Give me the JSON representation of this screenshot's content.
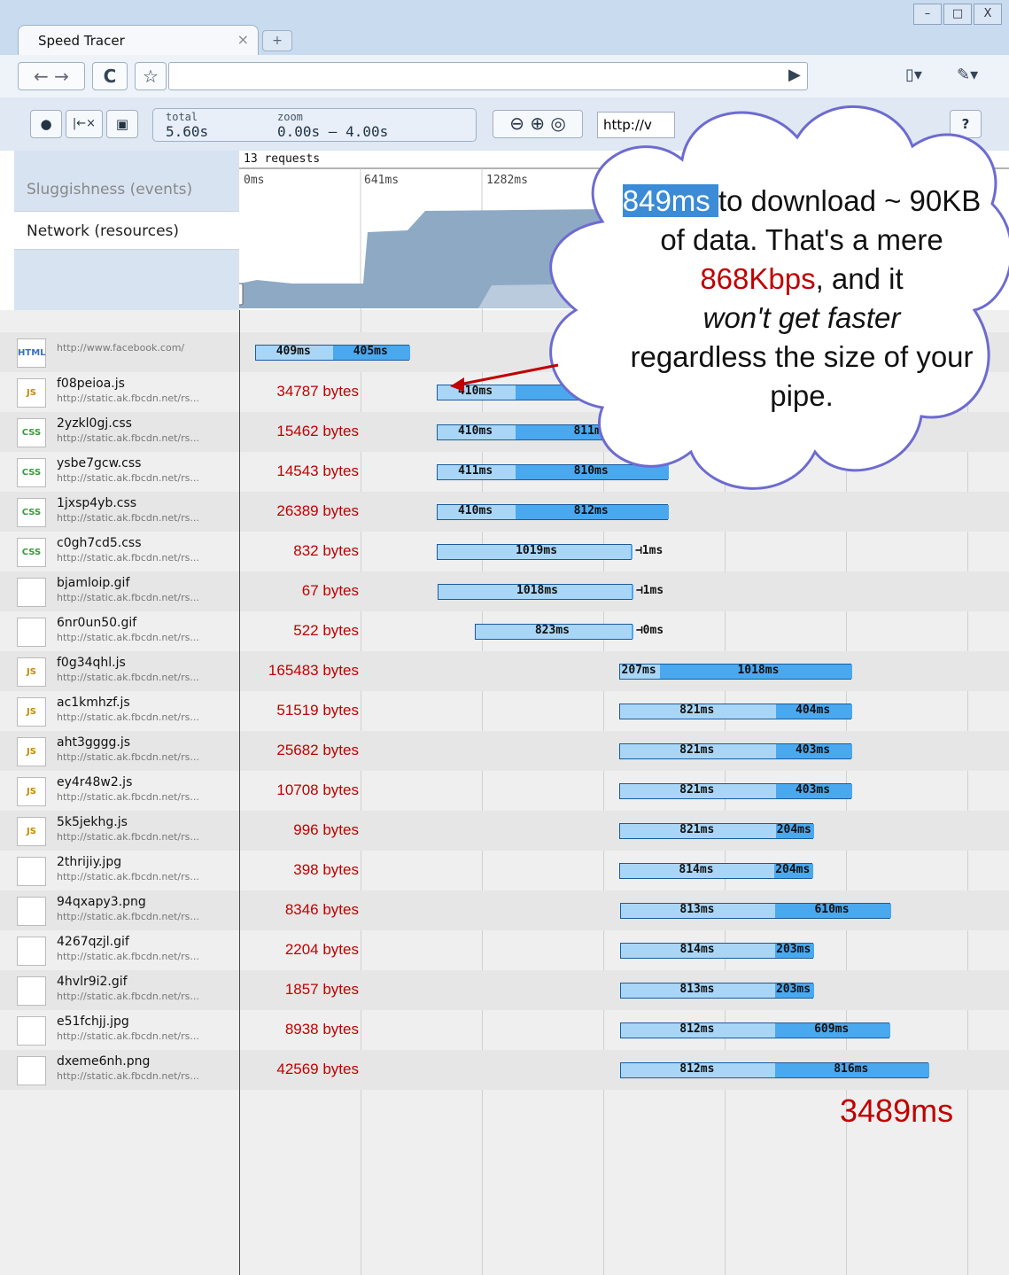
{
  "window": {
    "tab_title": "Speed Tracer",
    "tab_close": "×",
    "new_tab": "+",
    "controls": [
      "–",
      "□",
      "X"
    ]
  },
  "toolbar": {
    "back": "←",
    "forward": "→",
    "reload": "C",
    "star": "☆",
    "go": "▶",
    "page_menu": "▯▾",
    "wrench_menu": "✎▾"
  },
  "tracer": {
    "record_icon": "●",
    "clear_icon": "|←×",
    "save_icon": "▣",
    "total_label": "total",
    "total_value": "5.60s",
    "zoom_label": "zoom",
    "zoom_value": "0.00s – 4.00s",
    "zoom_out": "⊖",
    "zoom_in": "⊕",
    "zoom_fit": "◎",
    "url_value": "http://v",
    "help": "?"
  },
  "overview": {
    "tab_sluggishness": "Sluggishness (events)",
    "tab_network": "Network (resources)",
    "requests_label": "13 requests",
    "ticks": [
      "0ms",
      "641ms",
      "1282ms"
    ]
  },
  "resources": [
    {
      "name": "",
      "url": "http://www.facebook.com/",
      "icon": "HTML",
      "bytes": "",
      "latency": "409ms",
      "download": "405ms",
      "lat_start": 0,
      "lat_ms": 409,
      "dl_ms": 405
    },
    {
      "name": "f08peioa.js",
      "url": "http://static.ak.fbcdn.net/rs...",
      "icon": "JS",
      "bytes": "34787 bytes",
      "latency": "410ms",
      "download": "849ms",
      "lat_start": 960,
      "lat_ms": 410,
      "dl_ms": 849
    },
    {
      "name": "2yzkl0gj.css",
      "url": "http://static.ak.fbcdn.net/rs...",
      "icon": "CSS",
      "bytes": "15462 bytes",
      "latency": "410ms",
      "download": "811ms",
      "lat_start": 960,
      "lat_ms": 410,
      "dl_ms": 811
    },
    {
      "name": "ysbe7gcw.css",
      "url": "http://static.ak.fbcdn.net/rs...",
      "icon": "CSS",
      "bytes": "14543 bytes",
      "latency": "411ms",
      "download": "810ms",
      "lat_start": 960,
      "lat_ms": 411,
      "dl_ms": 810
    },
    {
      "name": "1jxsp4yb.css",
      "url": "http://static.ak.fbcdn.net/rs...",
      "icon": "CSS",
      "bytes": "26389 bytes",
      "latency": "410ms",
      "download": "812ms",
      "lat_start": 960,
      "lat_ms": 410,
      "dl_ms": 812
    },
    {
      "name": "c0gh7cd5.css",
      "url": "http://static.ak.fbcdn.net/rs...",
      "icon": "CSS",
      "bytes": "832 bytes",
      "latency": "1019ms",
      "download": "1ms",
      "lat_start": 960,
      "lat_ms": 1019,
      "dl_ms": 1
    },
    {
      "name": "bjamloip.gif",
      "url": "http://static.ak.fbcdn.net/rs...",
      "icon": "",
      "bytes": "67 bytes",
      "latency": "1018ms",
      "download": "1ms",
      "lat_start": 965,
      "lat_ms": 1018,
      "dl_ms": 1
    },
    {
      "name": "6nr0un50.gif",
      "url": "http://static.ak.fbcdn.net/rs...",
      "icon": "",
      "bytes": "522 bytes",
      "latency": "823ms",
      "download": "0ms",
      "lat_start": 1160,
      "lat_ms": 823,
      "dl_ms": 0
    },
    {
      "name": "f0g34qhl.js",
      "url": "http://static.ak.fbcdn.net/rs...",
      "icon": "JS",
      "bytes": "165483 bytes",
      "latency": "207ms",
      "download": "1018ms",
      "lat_start": 1925,
      "lat_ms": 207,
      "dl_ms": 1018
    },
    {
      "name": "ac1kmhzf.js",
      "url": "http://static.ak.fbcdn.net/rs...",
      "icon": "JS",
      "bytes": "51519 bytes",
      "latency": "821ms",
      "download": "404ms",
      "lat_start": 1925,
      "lat_ms": 821,
      "dl_ms": 404
    },
    {
      "name": "aht3gggg.js",
      "url": "http://static.ak.fbcdn.net/rs...",
      "icon": "JS",
      "bytes": "25682 bytes",
      "latency": "821ms",
      "download": "403ms",
      "lat_start": 1925,
      "lat_ms": 821,
      "dl_ms": 403
    },
    {
      "name": "ey4r48w2.js",
      "url": "http://static.ak.fbcdn.net/rs...",
      "icon": "JS",
      "bytes": "10708 bytes",
      "latency": "821ms",
      "download": "403ms",
      "lat_start": 1925,
      "lat_ms": 821,
      "dl_ms": 403
    },
    {
      "name": "5k5jekhg.js",
      "url": "http://static.ak.fbcdn.net/rs...",
      "icon": "JS",
      "bytes": "996 bytes",
      "latency": "821ms",
      "download": "204ms",
      "lat_start": 1925,
      "lat_ms": 821,
      "dl_ms": 204
    },
    {
      "name": "2thrijiy.jpg",
      "url": "http://static.ak.fbcdn.net/rs...",
      "icon": "",
      "bytes": "398 bytes",
      "latency": "814ms",
      "download": "204ms",
      "lat_start": 1925,
      "lat_ms": 814,
      "dl_ms": 204
    },
    {
      "name": "94qxapy3.png",
      "url": "http://static.ak.fbcdn.net/rs...",
      "icon": "",
      "bytes": "8346 bytes",
      "latency": "813ms",
      "download": "610ms",
      "lat_start": 1930,
      "lat_ms": 813,
      "dl_ms": 610
    },
    {
      "name": "4267qzjl.gif",
      "url": "http://static.ak.fbcdn.net/rs...",
      "icon": "",
      "bytes": "2204 bytes",
      "latency": "814ms",
      "download": "203ms",
      "lat_start": 1930,
      "lat_ms": 814,
      "dl_ms": 203
    },
    {
      "name": "4hvlr9i2.gif",
      "url": "http://static.ak.fbcdn.net/rs...",
      "icon": "",
      "bytes": "1857 bytes",
      "latency": "813ms",
      "download": "203ms",
      "lat_start": 1930,
      "lat_ms": 813,
      "dl_ms": 203
    },
    {
      "name": "e51fchjj.jpg",
      "url": "http://static.ak.fbcdn.net/rs...",
      "icon": "",
      "bytes": "8938 bytes",
      "latency": "812ms",
      "download": "609ms",
      "lat_start": 1930,
      "lat_ms": 812,
      "dl_ms": 609
    },
    {
      "name": "dxeme6nh.png",
      "url": "http://static.ak.fbcdn.net/rs...",
      "icon": "",
      "bytes": "42569 bytes",
      "latency": "812ms",
      "download": "816ms",
      "lat_start": 1930,
      "lat_ms": 812,
      "dl_ms": 816
    }
  ],
  "annotation": {
    "total": "3489ms",
    "callout_highlight": "849ms ",
    "callout_p1": "to download ~ 90KB of data.  That's a mere ",
    "callout_red": "868Kbps",
    "callout_p2": ", and it",
    "callout_italic": "won't get faster",
    "callout_p3": "regardless the size of your pipe."
  },
  "colors": {
    "latency_bar": "#a9d6f6",
    "download_bar": "#4aa8ef",
    "bytes_text": "#c00000",
    "highlight": "#3b8bd6"
  }
}
